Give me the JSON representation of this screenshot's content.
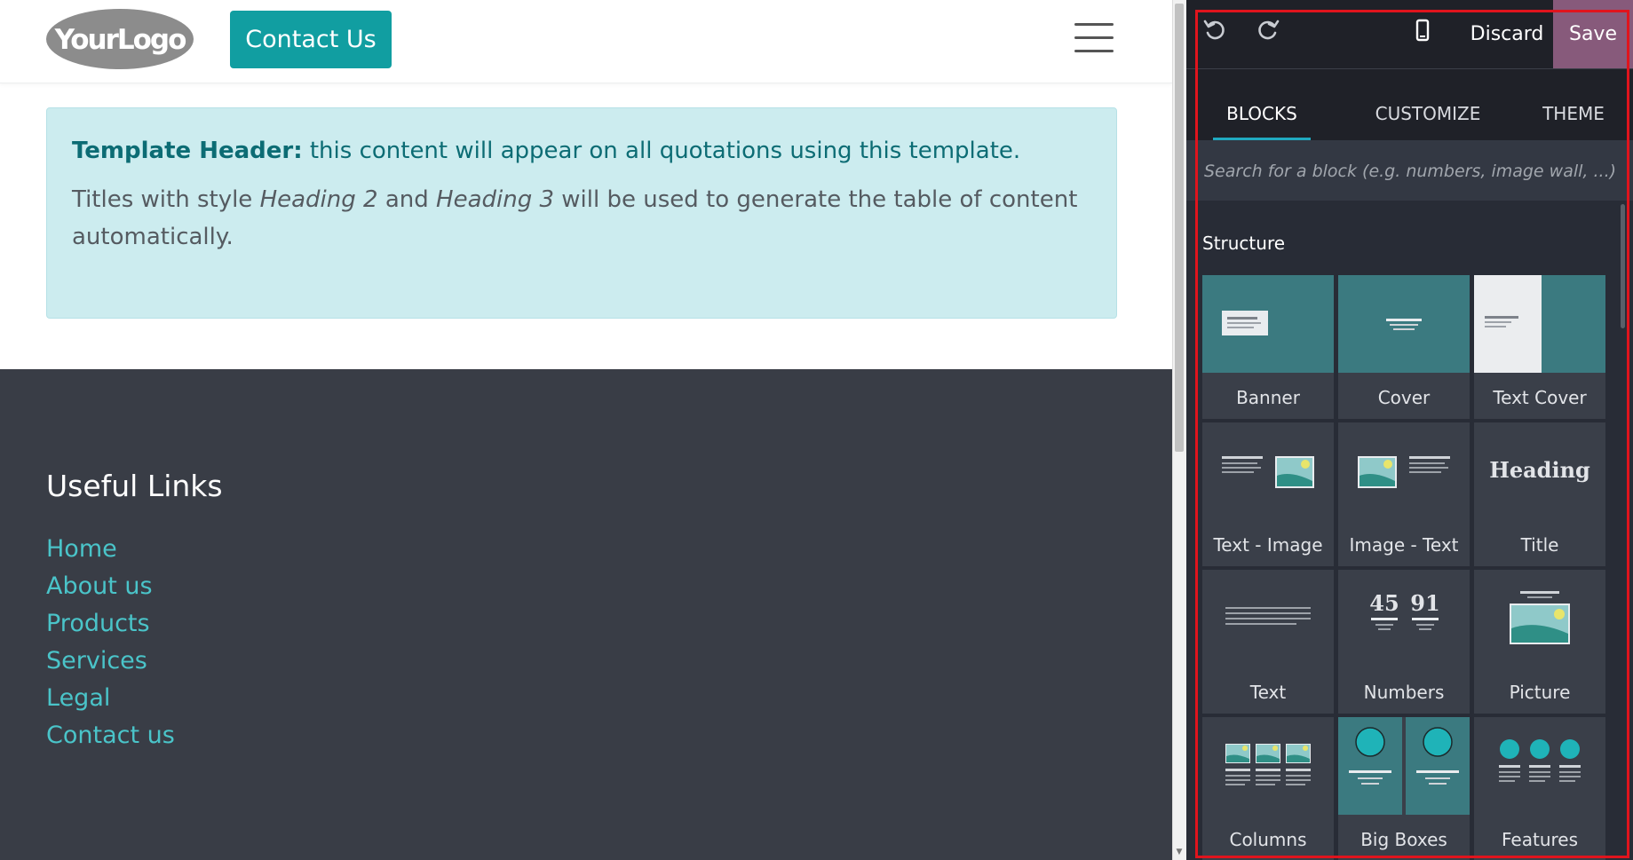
{
  "site": {
    "logo_text": "YourLogo",
    "contact_button": "Contact Us",
    "template_header": {
      "bold": "Template Header:",
      "rest": " this content will appear on all quotations using this template."
    },
    "toc_note": {
      "part1": "Titles with style ",
      "em1": "Heading 2",
      "part2": " and ",
      "em2": "Heading 3",
      "part3": " will be used to generate the table of content automatically."
    },
    "footer": {
      "title": "Useful Links",
      "links": [
        "Home",
        "About us",
        "Products",
        "Services",
        "Legal",
        "Contact us"
      ]
    }
  },
  "editor": {
    "discard_label": "Discard",
    "save_label": "Save",
    "tabs": [
      "BLOCKS",
      "CUSTOMIZE",
      "THEME"
    ],
    "active_tab": "BLOCKS",
    "search_placeholder": "Search for a block (e.g. numbers, image wall, ...)",
    "section_title": "Structure",
    "blocks": [
      {
        "label": "Banner",
        "icon": "banner-icon"
      },
      {
        "label": "Cover",
        "icon": "cover-icon"
      },
      {
        "label": "Text Cover",
        "icon": "text-cover-icon"
      },
      {
        "label": "Text - Image",
        "icon": "text-image-icon"
      },
      {
        "label": "Image - Text",
        "icon": "image-text-icon"
      },
      {
        "label": "Title",
        "icon": "title-icon",
        "thumb_text": "Heading"
      },
      {
        "label": "Text",
        "icon": "text-icon"
      },
      {
        "label": "Numbers",
        "icon": "numbers-icon",
        "thumb_numbers": [
          "45",
          "91"
        ]
      },
      {
        "label": "Picture",
        "icon": "picture-icon"
      },
      {
        "label": "Columns",
        "icon": "columns-icon"
      },
      {
        "label": "Big Boxes",
        "icon": "big-boxes-icon"
      },
      {
        "label": "Features",
        "icon": "features-icon"
      }
    ]
  },
  "colors": {
    "teal_button": "#119ea1",
    "link": "#4ac4c9",
    "footer_bg": "#393d46",
    "panel_bg": "#282c36",
    "save_bg": "#875a7b",
    "highlight_outline": "#e0141d",
    "tile_teal": "#3b7a80",
    "accent_circle": "#1fb3b8"
  }
}
